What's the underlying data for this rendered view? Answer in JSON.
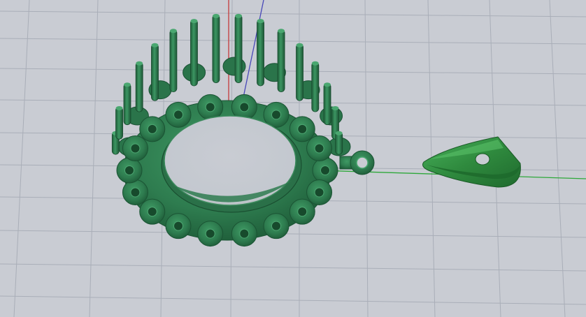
{
  "viewport": {
    "view": "perspective",
    "background_color": "#c9ccd3",
    "grid_color": "#a9aeb8",
    "axis_colors": {
      "x": "#2ea83a",
      "y": "#4848b8",
      "z": "#c43a3a"
    }
  },
  "objects": [
    {
      "name": "pendant-gallery",
      "type": "oval-setting",
      "prong_count": 16,
      "hole_count": 18,
      "color": "#2e7c4f"
    },
    {
      "name": "bail-loop",
      "type": "ring",
      "color": "#2e7c4f"
    },
    {
      "name": "bail",
      "type": "wedge-bail",
      "color": "#2f8a3e"
    }
  ]
}
